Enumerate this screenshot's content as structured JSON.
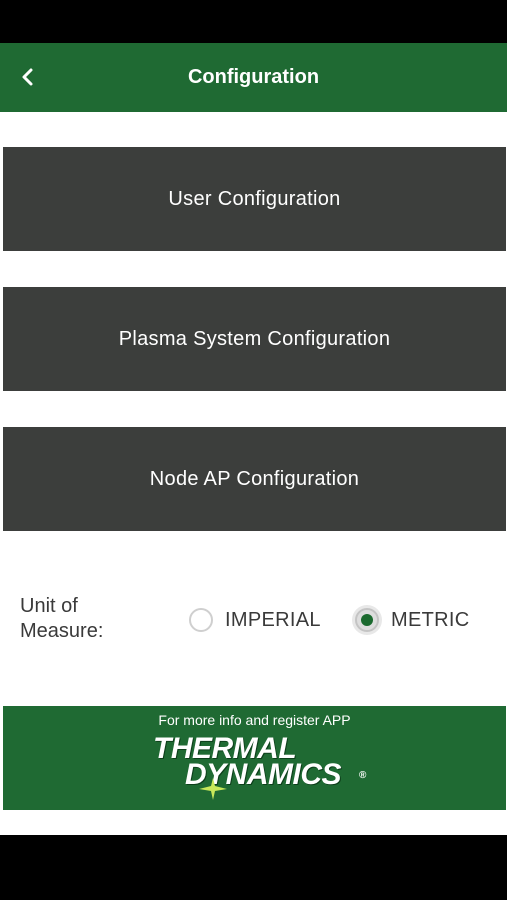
{
  "header": {
    "title": "Configuration"
  },
  "menu": {
    "items": [
      {
        "label": "User Configuration"
      },
      {
        "label": "Plasma System Configuration"
      },
      {
        "label": "Node AP Configuration"
      }
    ]
  },
  "units": {
    "label_line1": "Unit of",
    "label_line2": "Measure:",
    "options": [
      {
        "label": "IMPERIAL",
        "selected": false
      },
      {
        "label": "METRIC",
        "selected": true
      }
    ]
  },
  "footer": {
    "text": "For more info and register APP",
    "logo_line1": "THERMAL",
    "logo_line2": "DYNAMICS",
    "logo_mark": "®"
  },
  "colors": {
    "brand_green": "#1f6a33",
    "button_gray": "#3c3e3c",
    "radio_selected": "#1b6a2f"
  }
}
